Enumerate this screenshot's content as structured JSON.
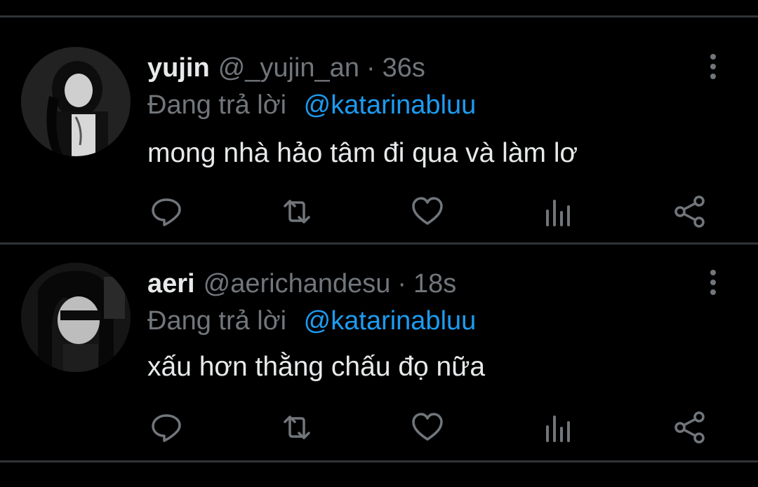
{
  "tweets": [
    {
      "display_name": "yujin",
      "handle": "@_yujin_an",
      "separator": "·",
      "time": "36s",
      "reply_label": "Đang trả lời",
      "reply_to": "@katarinabluu",
      "text": "mong nhà hảo tâm đi qua và làm lơ"
    },
    {
      "display_name": "aeri",
      "handle": "@aerichandesu",
      "separator": "·",
      "time": "18s",
      "reply_label": "Đang trả lời",
      "reply_to": "@katarinabluu",
      "text": "xấu hơn thằng chấu đọ nữa"
    }
  ],
  "icons": {
    "reply": "reply-icon",
    "retweet": "retweet-icon",
    "like": "heart-icon",
    "analytics": "analytics-icon",
    "share": "share-icon",
    "more": "more-vertical-icon"
  },
  "colors": {
    "background": "#000000",
    "text_primary": "#e7e9ea",
    "text_secondary": "#71767b",
    "accent": "#1d9bf0",
    "divider": "#2f3336"
  }
}
